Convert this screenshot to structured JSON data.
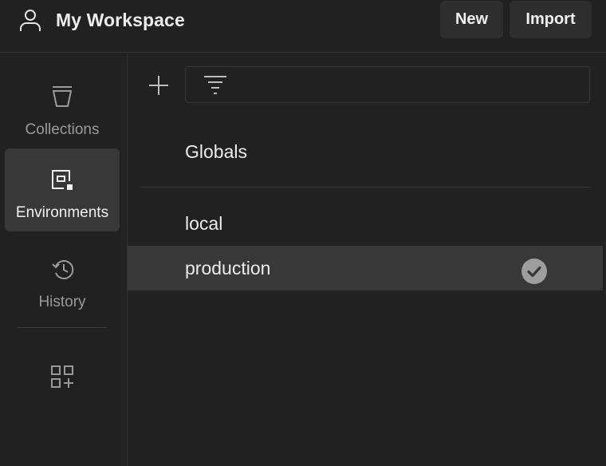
{
  "header": {
    "workspace_title": "My Workspace",
    "new_label": "New",
    "import_label": "Import"
  },
  "sidebar": {
    "items": [
      {
        "id": "collections",
        "label": "Collections",
        "icon": "collections-icon",
        "active": false
      },
      {
        "id": "environments",
        "label": "Environments",
        "icon": "environments-icon",
        "active": true
      },
      {
        "id": "history",
        "label": "History",
        "icon": "history-icon",
        "active": false
      }
    ],
    "apps_icon": "add-apps-icon"
  },
  "main": {
    "add_icon": "plus-icon",
    "filter_icon": "filter-icon",
    "filter_value": "",
    "environments": [
      {
        "label": "Globals",
        "selected": false,
        "active": false
      },
      {
        "label": "local",
        "selected": false,
        "active": false
      },
      {
        "label": "production",
        "selected": true,
        "active": true
      }
    ]
  },
  "colors": {
    "background": "#212121",
    "selected_row": "#383838",
    "button_bg": "#2e2e2e",
    "text_primary": "#ececec",
    "text_muted": "#9a9a9a"
  }
}
